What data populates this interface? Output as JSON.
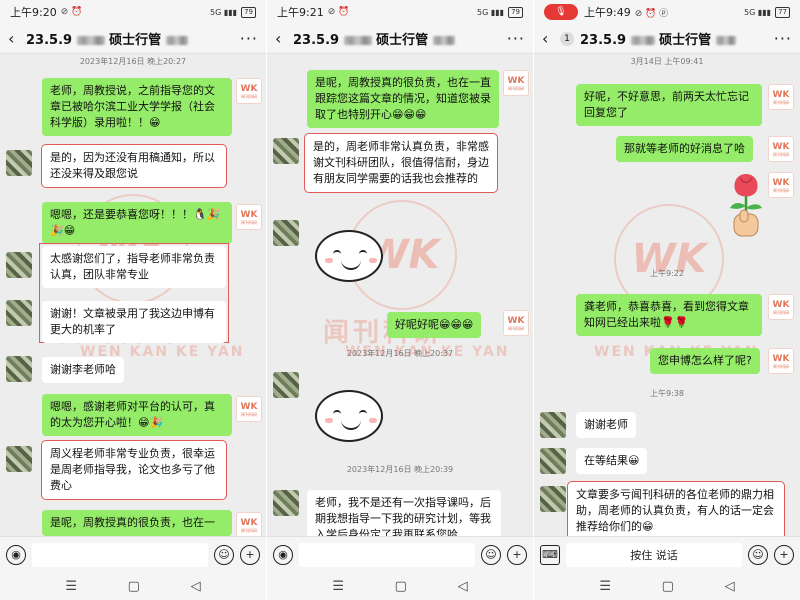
{
  "screens": [
    {
      "status": {
        "time": "上午9:20",
        "battery": "79",
        "extra": "⊘ ⏰"
      },
      "header": {
        "back": "‹",
        "title_prefix": "23.5.9",
        "title_suffix": "硕士行管",
        "more": "···"
      },
      "messages": {
        "ts1": "2023年12月16日 晚上20:27",
        "m1": "老师，周教授说，之前指导您的文章已被哈尔滨工业大学学报（社会科学版）录用啦！！😁",
        "m2": "是的，因为还没有用稿通知，所以还没来得及跟您说",
        "m3": "嗯嗯，还是要恭喜您呀！！！🐧🎉🎉😁",
        "m4": "太感谢您们了，指导老师非常负责认真，团队非常专业",
        "m5": "谢谢！文章被录用了我这边申博有更大的机率了",
        "m6": "谢谢李老师哈",
        "m7": "嗯嗯，感谢老师对平台的认可，真的太为您开心啦！😁🎉",
        "m8": "周义程老师非常专业负责，很幸运是周老师指导我，论文也多亏了他费心",
        "m9": "是呢，周教授真的很负责，也在一"
      }
    },
    {
      "status": {
        "time": "上午9:21",
        "battery": "79",
        "extra": "⊘ ⏰"
      },
      "header": {
        "back": "‹",
        "title_prefix": "23.5.9",
        "title_suffix": "硕士行管",
        "more": "···"
      },
      "messages": {
        "m1": "是呢，周教授真的很负责，也在一直跟踪您这篇文章的情况，知道您被录取了也特别开心😁😁😁",
        "m2": "是的，周老师非常认真负责，非常感谢文刊科研团队，很值得信耐，身边有朋友同学需要的话我也会推荐的",
        "m3": "好呢好呢😁😁😁",
        "ts1": "2023年12月16日 晚上20:37",
        "ts2": "2023年12月16日 晚上20:39",
        "m4": "老师，我不是还有一次指导课吗，后期我想指导一下我的研究计划，等我入学后身份定了我再联系您哈"
      }
    },
    {
      "status": {
        "time": "上午9:49",
        "battery": "77",
        "extra": "⊘ ⏰ ⓟ"
      },
      "header": {
        "back": "‹",
        "count": "1",
        "title_prefix": "23.5.9",
        "title_suffix": "硕士行管",
        "more": "···"
      },
      "messages": {
        "ts1": "3月14日 上午09:41",
        "m1": "好呢，不好意思，前两天太忙忘记回复您了",
        "m2": "那就等老师的好消息了哈",
        "ts2": "上午9:22",
        "m3": "龚老师，恭喜恭喜，看到您得文章知网已经出来啦🌹🌹",
        "m4": "您申博怎么样了呢?",
        "ts3": "上午9:38",
        "m5": "谢谢老师",
        "m6": "在等结果😀",
        "m7": "文章要多亏闻刊科研的各位老师的鼎力相助，周老师的认真负责，有人的话一定会推荐给你们的😁"
      },
      "input": {
        "hold_to_talk": "按住 说话"
      }
    }
  ],
  "watermark": {
    "logo": "WK",
    "cn": "闻刊科研",
    "en": "WEN KAN KE YAN",
    "small": "闻刊科研"
  },
  "colors": {
    "sent": "#95ec69",
    "received": "#ffffff",
    "highlight": "#e05a5a",
    "bg": "#ededed"
  }
}
